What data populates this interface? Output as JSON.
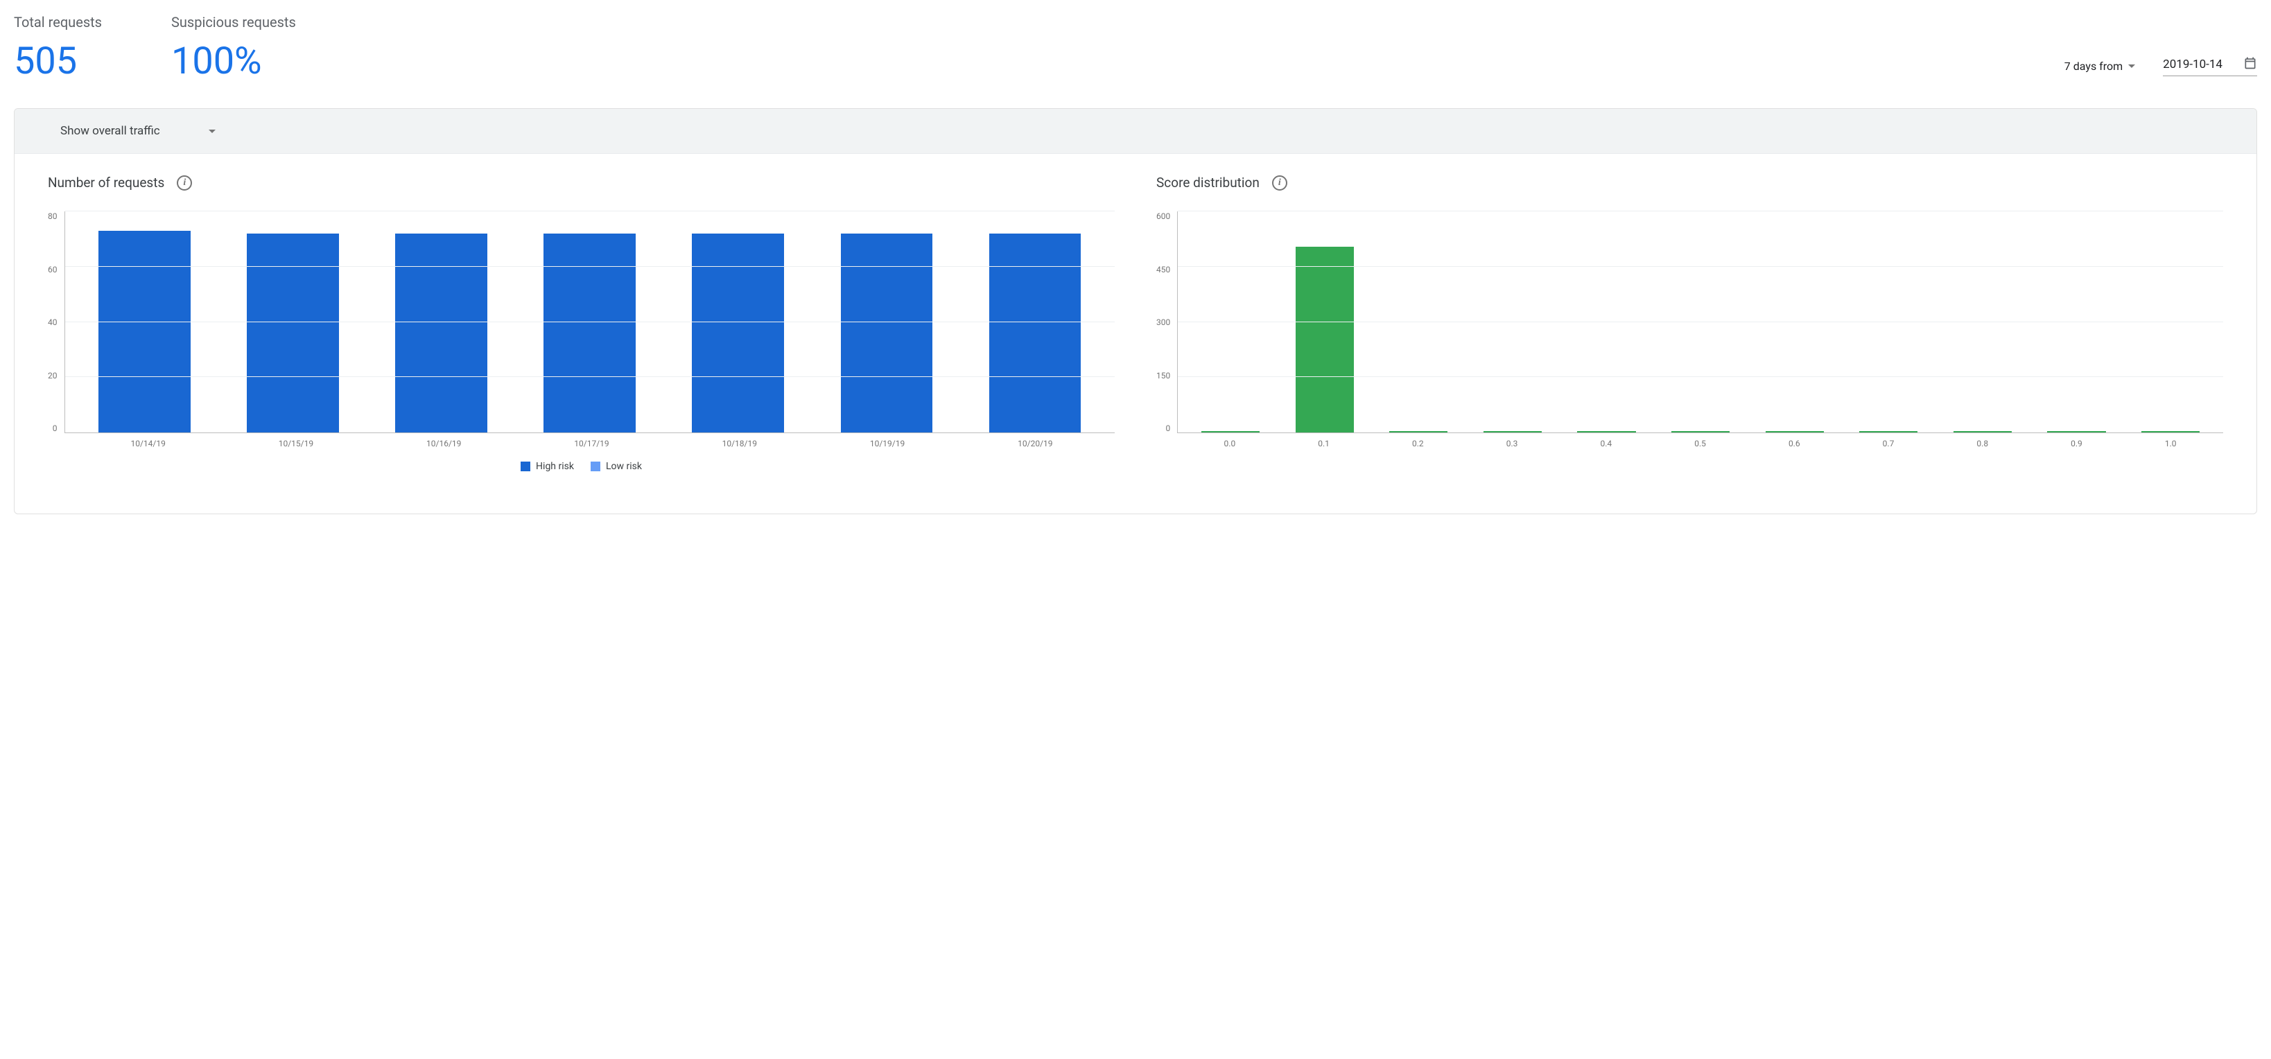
{
  "header": {
    "total_requests_label": "Total requests",
    "total_requests_value": "505",
    "suspicious_requests_label": "Suspicious requests",
    "suspicious_requests_value": "100%",
    "date_range_label": "7 days from",
    "date_value": "2019-10-14"
  },
  "filter": {
    "label": "Show overall traffic"
  },
  "chart_left": {
    "title": "Number of requests",
    "legend": {
      "high": "High risk",
      "low": "Low risk"
    }
  },
  "chart_right": {
    "title": "Score distribution"
  },
  "chart_data": [
    {
      "type": "bar",
      "title": "Number of requests",
      "categories": [
        "10/14/19",
        "10/15/19",
        "10/16/19",
        "10/17/19",
        "10/18/19",
        "10/19/19",
        "10/20/19"
      ],
      "series": [
        {
          "name": "High risk",
          "values": [
            73,
            72,
            72,
            72,
            72,
            72,
            72
          ],
          "color": "#1967d2"
        },
        {
          "name": "Low risk",
          "values": [
            0,
            0,
            0,
            0,
            0,
            0,
            0
          ],
          "color": "#669df6"
        }
      ],
      "ylim": [
        0,
        80
      ],
      "yticks": [
        0,
        20,
        40,
        60,
        80
      ],
      "xlabel": "",
      "ylabel": ""
    },
    {
      "type": "bar",
      "title": "Score distribution",
      "categories": [
        "0.0",
        "0.1",
        "0.2",
        "0.3",
        "0.4",
        "0.5",
        "0.6",
        "0.7",
        "0.8",
        "0.9",
        "1.0"
      ],
      "values": [
        0,
        505,
        0,
        0,
        0,
        0,
        0,
        0,
        0,
        0,
        0
      ],
      "color": "#34a853",
      "ylim": [
        0,
        600
      ],
      "yticks": [
        0,
        150,
        300,
        450,
        600
      ],
      "xlabel": "",
      "ylabel": ""
    }
  ]
}
